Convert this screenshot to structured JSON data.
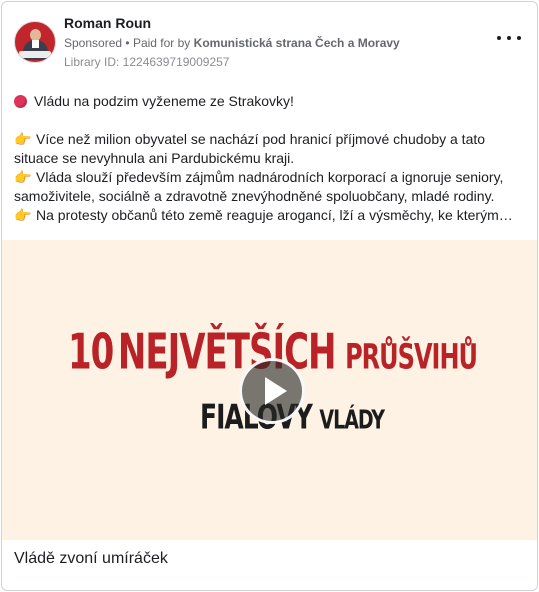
{
  "advertiser": {
    "name": "Roman Roun",
    "sponsored_label": "Sponsored",
    "paid_for_label": "Paid for by",
    "payer": "Komunistická strana Čech a Moravy",
    "library_id": "Library ID: 1224639719009257"
  },
  "post": {
    "line1": "Vládu na podzim vyženeme ze Strakovky!",
    "paragraph1": "Více než milion obyvatel se nachází pod hranicí příjmové chudoby a tato situace se nevyhnula ani Pardubickému kraji.",
    "paragraph2": "Vláda slouží především zájmům nadnárodních korporací a ignoruje seniory, samoživitele, sociálně a zdravotně znevýhodněné spoluobčany, mladé rodiny.",
    "paragraph3": "Na protesty občanů této země reaguje arogancí, lží a výsměchy, ke kterým…"
  },
  "media": {
    "headline_number": "10",
    "headline_big": "NEJVĚTŠÍCH",
    "headline_small": "PRŮŠVIHŮ",
    "headline2_big": "FIALOVY",
    "headline2_small": "VLÁDY",
    "background_color": "#fdf2e3",
    "accent_color": "#b92328"
  },
  "caption": "Vládě zvoní umíráček",
  "icons": {
    "menu": "more-dots-icon",
    "play": "play-icon",
    "emoji_red": "red-circle-icon",
    "emoji_hand": "pointing-hand-icon"
  }
}
